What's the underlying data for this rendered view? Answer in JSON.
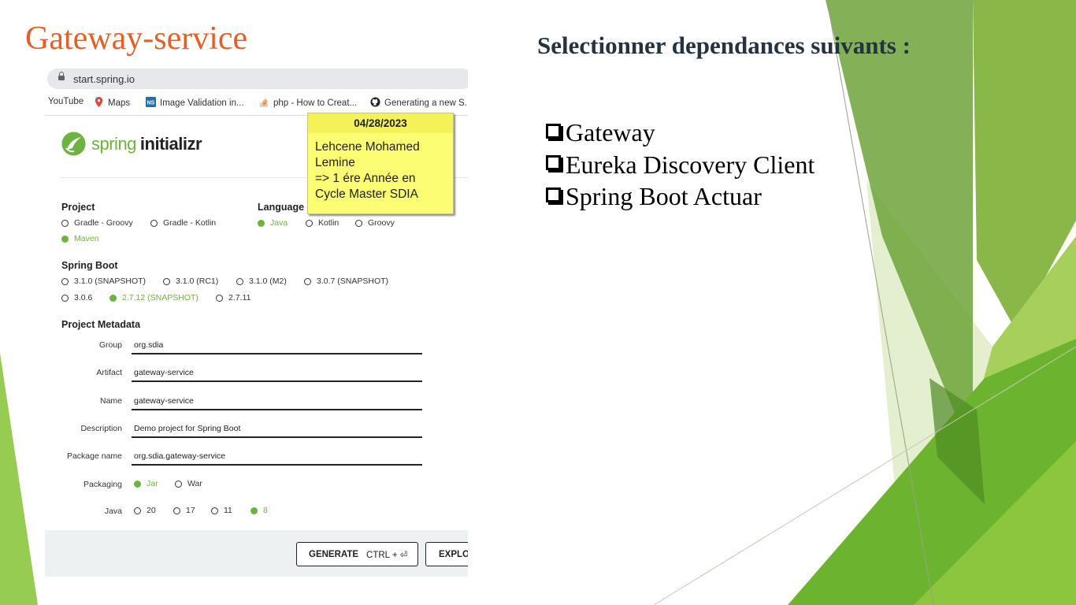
{
  "slide": {
    "title": "Gateway-service",
    "heading": "Selectionner dependances suivants :",
    "dependencies": [
      "Gateway",
      "Eureka Discovery Client",
      "Spring Boot Actuar"
    ]
  },
  "browser": {
    "url": "start.spring.io",
    "bookmarks": [
      "YouTube",
      "Maps",
      "Image Validation in...",
      "php - How to Creat...",
      "Generating a new S..."
    ],
    "bookmark_icons": [
      "maps-pin-icon",
      "ns-icon",
      "stackoverflow-icon",
      "github-icon"
    ]
  },
  "initializr": {
    "logo": {
      "word1": "spring",
      "word2": "initializr"
    },
    "project": {
      "label": "Project",
      "options": [
        "Gradle - Groovy",
        "Gradle - Kotlin",
        "Maven"
      ],
      "selected": "Maven"
    },
    "language": {
      "label": "Language",
      "options": [
        "Java",
        "Kotlin",
        "Groovy"
      ],
      "selected": "Java"
    },
    "spring_boot": {
      "label": "Spring Boot",
      "options": [
        "3.1.0 (SNAPSHOT)",
        "3.1.0 (RC1)",
        "3.1.0 (M2)",
        "3.0.7 (SNAPSHOT)",
        "3.0.6",
        "2.7.12 (SNAPSHOT)",
        "2.7.11"
      ],
      "selected": "2.7.12 (SNAPSHOT)"
    },
    "metadata": {
      "label": "Project Metadata",
      "fields": [
        {
          "label": "Group",
          "value": "org.sdia"
        },
        {
          "label": "Artifact",
          "value": "gateway-service"
        },
        {
          "label": "Name",
          "value": "gateway-service"
        },
        {
          "label": "Description",
          "value": "Demo project for Spring Boot"
        },
        {
          "label": "Package name",
          "value": "org.sdia.gateway-service"
        }
      ],
      "packaging": {
        "label": "Packaging",
        "options": [
          "Jar",
          "War"
        ],
        "selected": "Jar"
      },
      "java": {
        "label": "Java",
        "options": [
          "20",
          "17",
          "11",
          "8"
        ],
        "selected": "8"
      }
    },
    "buttons": {
      "generate": "GENERATE",
      "generate_shortcut": "CTRL + ⏎",
      "explore": "EXPLO"
    }
  },
  "sticky_note": {
    "date": "04/28/2023",
    "lines": [
      "Lehcene Mohamed",
      "Lemine",
      "=> 1 ére Année en",
      "Cycle Master SDIA"
    ]
  },
  "colors": {
    "title": "#e0622a",
    "heading": "#24333f",
    "spring_green": "#6db33f",
    "note_yellow": "#fdfd74"
  }
}
